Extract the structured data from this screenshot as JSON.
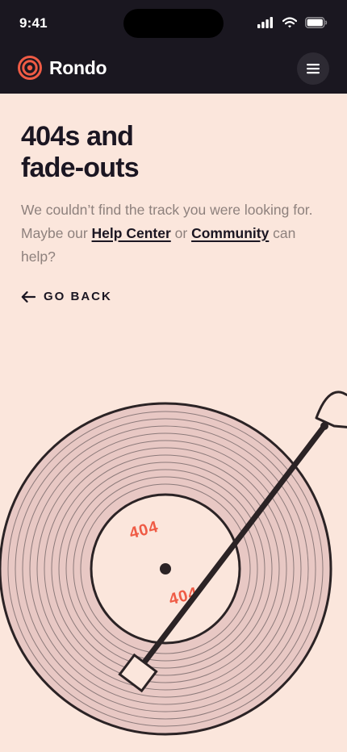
{
  "status_bar": {
    "time": "9:41",
    "icons": [
      "signal-icon",
      "wifi-icon",
      "battery-icon"
    ]
  },
  "navbar": {
    "brand": "Rondo",
    "logo_icon": "vinyl-logo-icon",
    "menu_icon": "hamburger-menu-icon",
    "background": "#1a1720",
    "accent": "#ef5b45"
  },
  "error": {
    "title_line1": "404s and",
    "title_line2": "fade-outs",
    "message_part1": "We couldn’t find the track you were looking for. Maybe our ",
    "help_link": "Help Center",
    "message_part2": " or ",
    "community_link": "Community",
    "message_part3": " can help?",
    "go_back_label": "GO BACK",
    "go_back_icon": "arrow-left-icon"
  },
  "illustration": {
    "label_top": "404",
    "label_bottom": "404",
    "record_color": "#e8c8c4",
    "label_color": "#ef5b45"
  }
}
